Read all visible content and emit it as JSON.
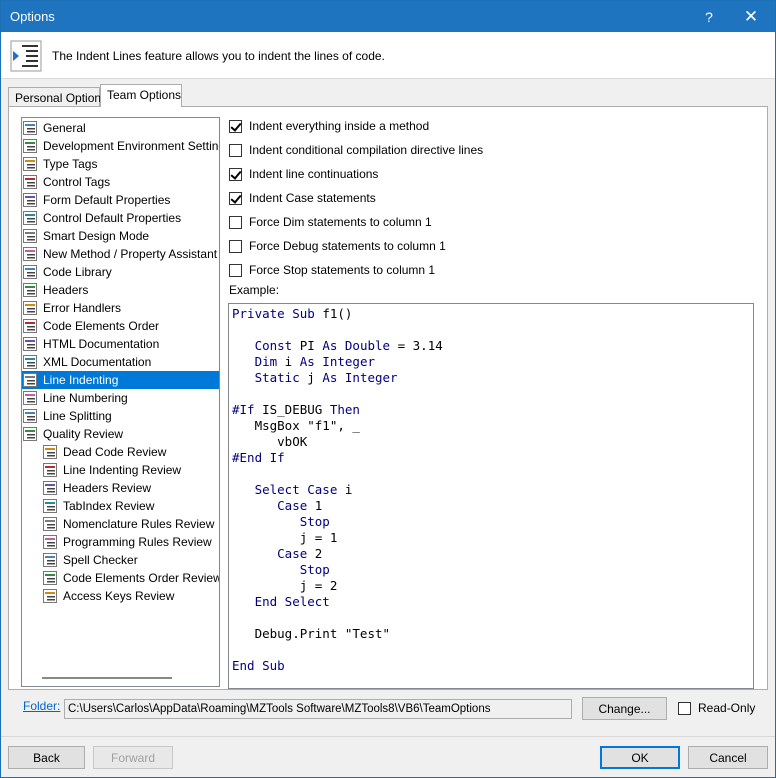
{
  "window": {
    "title": "Options",
    "help_label": "?",
    "close_label": "✕"
  },
  "header": {
    "text": "The Indent Lines feature allows you to indent the lines of code."
  },
  "tabs": [
    {
      "label": "Personal Options",
      "active": false
    },
    {
      "label": "Team Options",
      "active": true
    }
  ],
  "tree": {
    "items": [
      {
        "label": "General",
        "icon": "general-icon"
      },
      {
        "label": "Development Environment Settings R",
        "icon": "dev-env-icon"
      },
      {
        "label": "Type Tags",
        "icon": "type-tags-icon"
      },
      {
        "label": "Control Tags",
        "icon": "control-tags-icon"
      },
      {
        "label": "Form Default Properties",
        "icon": "form-default-icon"
      },
      {
        "label": "Control Default Properties",
        "icon": "control-default-icon"
      },
      {
        "label": "Smart Design Mode",
        "icon": "smart-design-icon"
      },
      {
        "label": "New Method / Property Assistant",
        "icon": "new-method-icon"
      },
      {
        "label": "Code Library",
        "icon": "code-library-icon"
      },
      {
        "label": "Headers",
        "icon": "headers-icon"
      },
      {
        "label": "Error Handlers",
        "icon": "error-handlers-icon"
      },
      {
        "label": "Code Elements Order",
        "icon": "code-elements-order-icon"
      },
      {
        "label": "HTML Documentation",
        "icon": "html-doc-icon"
      },
      {
        "label": "XML Documentation",
        "icon": "xml-doc-icon"
      },
      {
        "label": "Line Indenting",
        "icon": "line-indenting-icon",
        "selected": true
      },
      {
        "label": "Line Numbering",
        "icon": "line-numbering-icon"
      },
      {
        "label": "Line Splitting",
        "icon": "line-splitting-icon"
      },
      {
        "label": "Quality Review",
        "icon": "quality-review-icon"
      },
      {
        "label": "Dead Code Review",
        "icon": "dead-code-icon",
        "child": true
      },
      {
        "label": "Line Indenting Review",
        "icon": "line-indenting-review-icon",
        "child": true
      },
      {
        "label": "Headers Review",
        "icon": "headers-review-icon",
        "child": true
      },
      {
        "label": "TabIndex Review",
        "icon": "tabindex-review-icon",
        "child": true
      },
      {
        "label": "Nomenclature Rules Review",
        "icon": "nomenclature-icon",
        "child": true
      },
      {
        "label": "Programming Rules Review",
        "icon": "programming-rules-icon",
        "child": true
      },
      {
        "label": "Spell Checker",
        "icon": "spell-checker-icon",
        "child": true
      },
      {
        "label": "Code Elements Order Review",
        "icon": "code-elements-order-review-icon",
        "child": true
      },
      {
        "label": "Access Keys Review",
        "icon": "access-keys-icon",
        "child": true
      }
    ]
  },
  "options": [
    {
      "label": "Indent everything inside a method",
      "checked": true
    },
    {
      "label": "Indent conditional compilation directive lines",
      "checked": false
    },
    {
      "label": "Indent line continuations",
      "checked": true
    },
    {
      "label": "Indent Case statements",
      "checked": true
    },
    {
      "label": "Force Dim statements to column 1",
      "checked": false
    },
    {
      "label": "Force Debug statements to column 1",
      "checked": false
    },
    {
      "label": "Force Stop statements to column 1",
      "checked": false
    }
  ],
  "example_label": "Example:",
  "code_lines": [
    [
      [
        "kw",
        "Private Sub"
      ],
      [
        "t",
        " f1()"
      ]
    ],
    [],
    [
      [
        "t",
        "   "
      ],
      [
        "kw",
        "Const"
      ],
      [
        "t",
        " PI "
      ],
      [
        "kw",
        "As Double"
      ],
      [
        "t",
        " = 3.14"
      ]
    ],
    [
      [
        "t",
        "   "
      ],
      [
        "kw",
        "Dim"
      ],
      [
        "t",
        " i "
      ],
      [
        "kw",
        "As Integer"
      ]
    ],
    [
      [
        "t",
        "   "
      ],
      [
        "kw",
        "Static"
      ],
      [
        "t",
        " j "
      ],
      [
        "kw",
        "As Integer"
      ]
    ],
    [],
    [
      [
        "kw",
        "#If"
      ],
      [
        "t",
        " IS_DEBUG "
      ],
      [
        "kw",
        "Then"
      ]
    ],
    [
      [
        "t",
        "   MsgBox \"f1\", _"
      ]
    ],
    [
      [
        "t",
        "      vbOK"
      ]
    ],
    [
      [
        "kw",
        "#End If"
      ]
    ],
    [],
    [
      [
        "t",
        "   "
      ],
      [
        "kw",
        "Select Case"
      ],
      [
        "t",
        " i"
      ]
    ],
    [
      [
        "t",
        "      "
      ],
      [
        "kw",
        "Case"
      ],
      [
        "t",
        " 1"
      ]
    ],
    [
      [
        "t",
        "         "
      ],
      [
        "kw",
        "Stop"
      ]
    ],
    [
      [
        "t",
        "         j = 1"
      ]
    ],
    [
      [
        "t",
        "      "
      ],
      [
        "kw",
        "Case"
      ],
      [
        "t",
        " 2"
      ]
    ],
    [
      [
        "t",
        "         "
      ],
      [
        "kw",
        "Stop"
      ]
    ],
    [
      [
        "t",
        "         j = 2"
      ]
    ],
    [
      [
        "t",
        "   "
      ],
      [
        "kw",
        "End Select"
      ]
    ],
    [],
    [
      [
        "t",
        "   Debug.Print \"Test\""
      ]
    ],
    [],
    [
      [
        "kw",
        "End Sub"
      ]
    ]
  ],
  "folder": {
    "link_label": "Folder:",
    "path": "C:\\Users\\Carlos\\AppData\\Roaming\\MZTools Software\\MZTools8\\VB6\\TeamOptions",
    "change_label": "Change...",
    "readonly_label": "Read-Only",
    "readonly_checked": false
  },
  "buttons": {
    "back": "Back",
    "forward": "Forward",
    "ok": "OK",
    "cancel": "Cancel"
  },
  "colors": {
    "titlebar": "#1f74bf",
    "selection": "#0078d7",
    "keyword": "#000080",
    "link": "#0066cc"
  }
}
